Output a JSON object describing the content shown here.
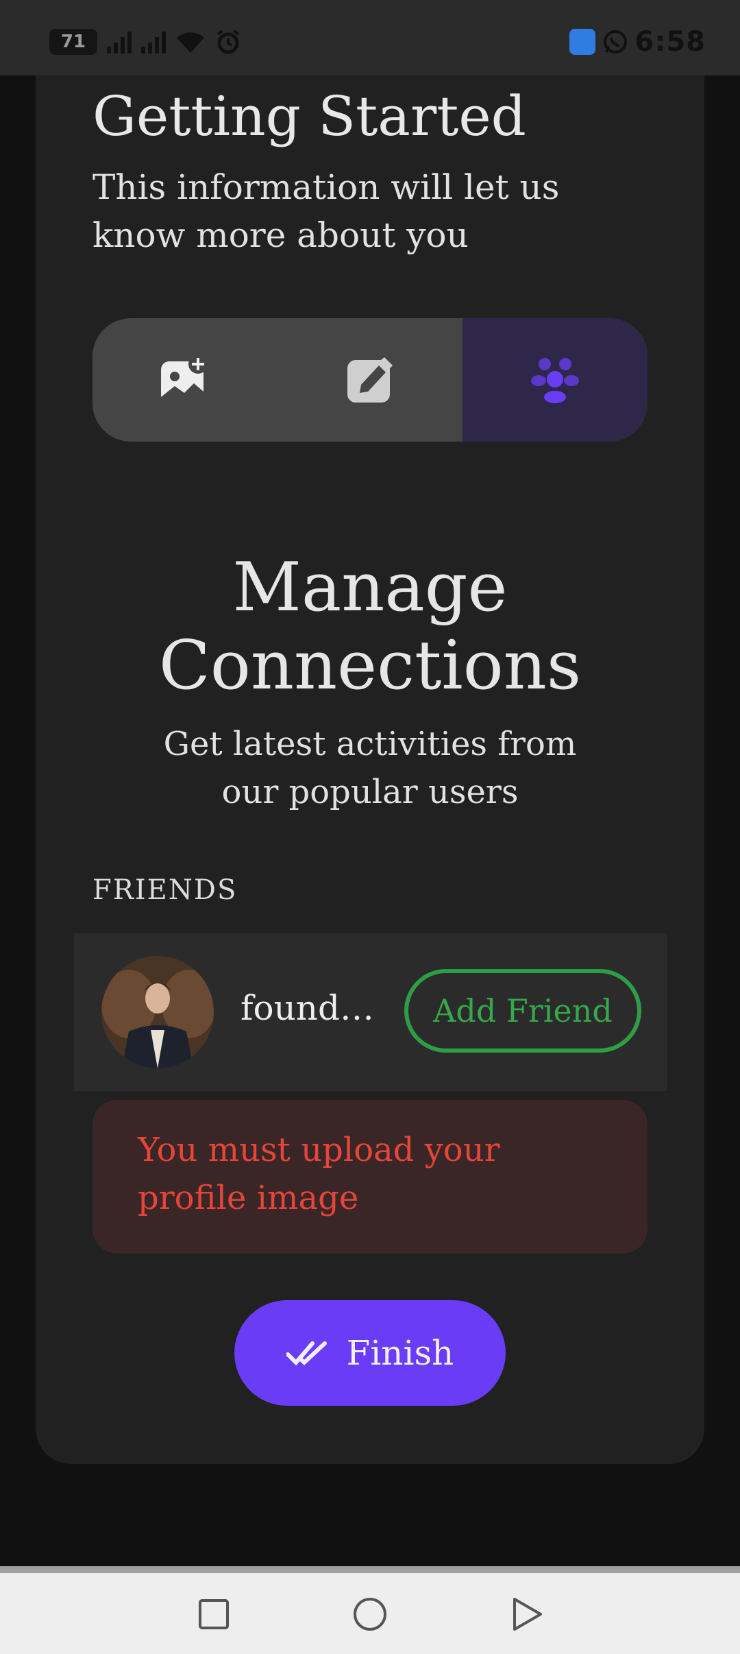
{
  "status_bar": {
    "battery": "71",
    "time": "6:58"
  },
  "header": {
    "title": "Getting Started",
    "subtitle": "This information will let us know more about you"
  },
  "steps": [
    {
      "icon": "add-image-icon",
      "active": false
    },
    {
      "icon": "edit-icon",
      "active": false
    },
    {
      "icon": "people-icon",
      "active": true
    }
  ],
  "section": {
    "title": "Manage Connections",
    "subtitle": "Get latest activities from our popular users"
  },
  "friends": {
    "label": "FRIENDS",
    "items": [
      {
        "name": "founder…",
        "action_label": "Add Friend"
      }
    ]
  },
  "error": {
    "message": "You must upload your profile image"
  },
  "finish_button": {
    "label": "Finish"
  },
  "colors": {
    "accent": "#6a3cf6",
    "success": "#2e9e44",
    "error": "#e6453a"
  }
}
